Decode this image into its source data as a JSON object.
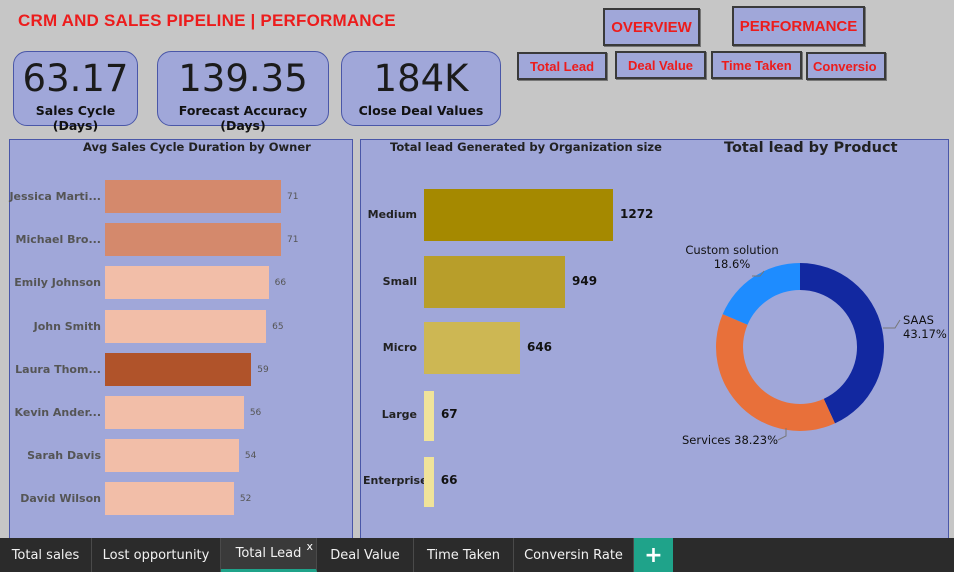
{
  "header": {
    "title": "CRM AND SALES PIPELINE | PERFORMANCE"
  },
  "nav": {
    "overview": "OVERVIEW",
    "performance": "PERFORMANCE",
    "total_lead": "Total Lead",
    "deal_value": "Deal Value",
    "time_taken": "Time Taken",
    "conversion": "Conversio"
  },
  "kpis": [
    {
      "value": "63.17",
      "label": "Sales Cycle (Days)"
    },
    {
      "value": "139.35",
      "label": "Forecast Accuracy (Days)"
    },
    {
      "value": "184K",
      "label": "Close Deal Values"
    }
  ],
  "colors": {
    "title_red": "#ec1c1c",
    "panel_bg": "#a0a7d9",
    "tab_accent": "#1fa38a"
  },
  "chart_data": [
    {
      "type": "bar",
      "title": "Avg Sales Cycle Duration by Owner",
      "orientation": "horizontal",
      "categories": [
        "Jessica Marti...",
        "Michael Bro...",
        "Emily Johnson",
        "John Smith",
        "Laura Thom...",
        "Kevin Ander...",
        "Sarah Davis",
        "David Wilson"
      ],
      "values": [
        71,
        71,
        66,
        65,
        59,
        56,
        54,
        52
      ],
      "bar_colors": [
        "#d4896c",
        "#d4896c",
        "#f2bea8",
        "#f2bea8",
        "#b0532a",
        "#f2bea8",
        "#f2bea8",
        "#f2bea8"
      ],
      "xlim": [
        0,
        90
      ]
    },
    {
      "type": "bar",
      "title": "Total lead Generated by Organization size",
      "orientation": "horizontal",
      "categories": [
        "Medium",
        "Small",
        "Micro",
        "Large",
        "Enterprise"
      ],
      "values": [
        1272,
        949,
        646,
        67,
        66
      ],
      "bar_colors": [
        "#a58900",
        "#b89e2a",
        "#cdb753",
        "#f0e39a",
        "#f0e39a"
      ],
      "xlim": [
        0,
        1600
      ]
    },
    {
      "type": "pie",
      "title": "Total lead by Product",
      "donut": true,
      "categories": [
        "SAAS",
        "Services",
        "Custom solution"
      ],
      "values": [
        43.17,
        38.23,
        18.6
      ],
      "labels": [
        "SAAS\n43.17%",
        "Services 38.23%",
        "Custom solution\n18.6%"
      ],
      "colors": [
        "#1228a0",
        "#e8703a",
        "#1e8cff"
      ]
    }
  ],
  "tabs": [
    "Total sales",
    "Lost opportunity",
    "Total Lead",
    "Deal Value",
    "Time Taken",
    "Conversin Rate"
  ],
  "tab_close": "x",
  "add_tab": "+"
}
